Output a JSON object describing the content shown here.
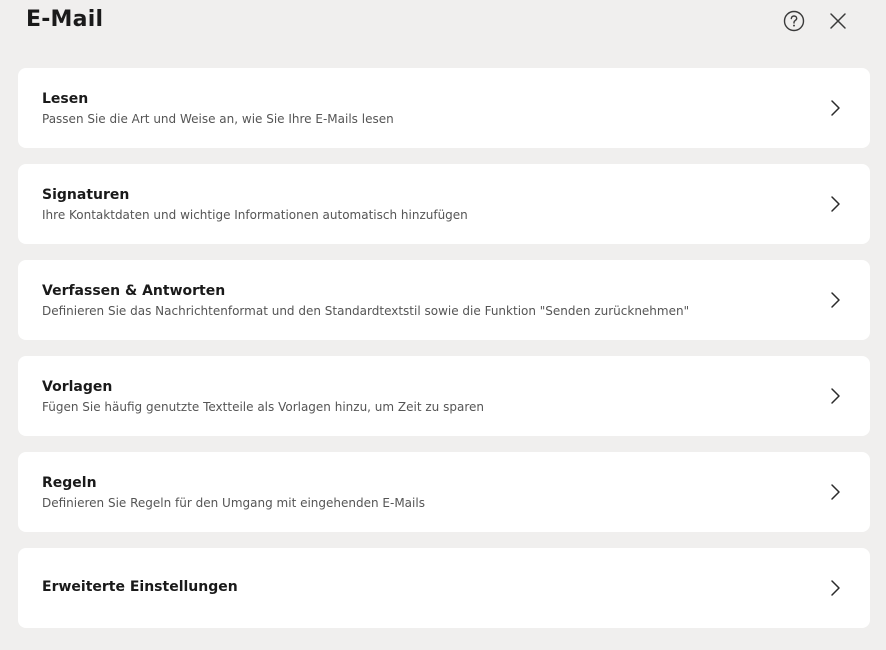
{
  "header": {
    "title": "E-Mail",
    "help_icon": "help-circle-icon",
    "close_icon": "close-icon"
  },
  "items": [
    {
      "title": "Lesen",
      "description": "Passen Sie die Art und Weise an, wie Sie Ihre E-Mails lesen"
    },
    {
      "title": "Signaturen",
      "description": "Ihre Kontaktdaten und wichtige Informationen automatisch hinzufügen"
    },
    {
      "title": "Verfassen & Antworten",
      "description": "Definieren Sie das Nachrichtenformat und den Standardtextstil sowie die Funktion \"Senden zurücknehmen\""
    },
    {
      "title": "Vorlagen",
      "description": "Fügen Sie häufig genutzte Textteile als Vorlagen hinzu, um Zeit zu sparen"
    },
    {
      "title": "Regeln",
      "description": "Definieren Sie Regeln für den Umgang mit eingehenden E-Mails"
    },
    {
      "title": "Erweiterte Einstellungen",
      "description": ""
    }
  ],
  "colors": {
    "background": "#f0efee",
    "card": "#ffffff",
    "text": "#1a1a1a",
    "secondary_text": "#555555"
  }
}
